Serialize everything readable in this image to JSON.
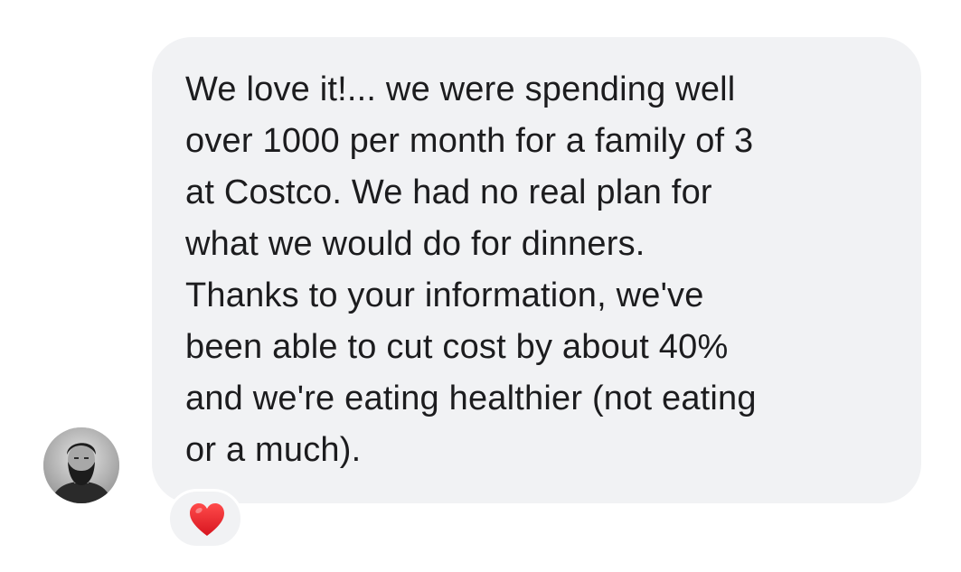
{
  "message": {
    "lines": [
      "We love it!... we were spending well",
      "over 1000 per month for a family of 3",
      "at Costco. We had no real plan for",
      "what we would do for dinners.",
      "Thanks to your information, we've",
      "been able to cut cost by about 40%",
      "and we're eating healthier (not eating",
      "or a much)."
    ]
  },
  "sender": {
    "avatar_icon": "person-avatar-icon"
  },
  "reaction": {
    "icon": "red-heart-icon",
    "color": "#e8202a"
  },
  "colors": {
    "bubble": "#f1f2f4",
    "text": "#1c1c1e",
    "background": "#ffffff"
  }
}
